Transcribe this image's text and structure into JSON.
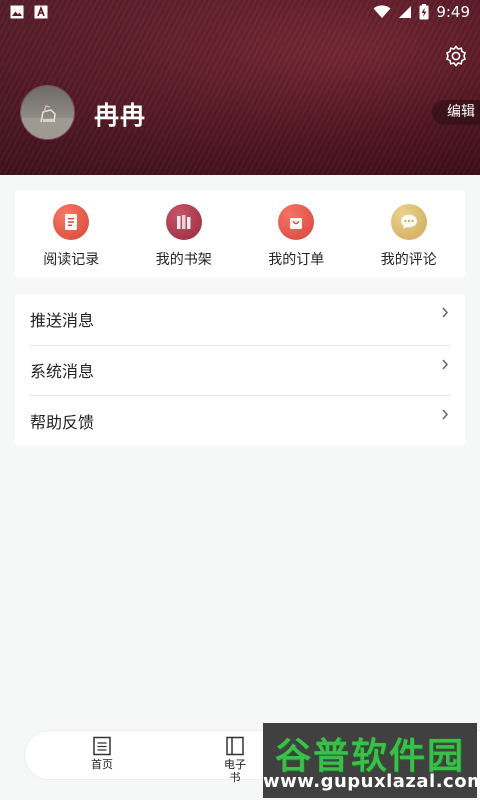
{
  "status_bar": {
    "time": "9:49",
    "left_icons": [
      "gallery-icon",
      "text-app-icon"
    ],
    "right_icons": [
      "wifi-icon",
      "signal-icon",
      "battery-charging-icon"
    ]
  },
  "profile": {
    "username": "冉冉",
    "edit_label": "编辑",
    "settings_icon": "gear-icon",
    "header_color": "#5c1623"
  },
  "quick_actions": [
    {
      "label": "阅读记录",
      "icon": "reading-history-icon",
      "color": "#e85a4a"
    },
    {
      "label": "我的书架",
      "icon": "bookshelf-icon",
      "color": "#b23a4e"
    },
    {
      "label": "我的订单",
      "icon": "shopping-bag-icon",
      "color": "#e8564a"
    },
    {
      "label": "我的评论",
      "icon": "chat-bubble-icon",
      "color": "#dcbc6e"
    }
  ],
  "menu": [
    {
      "label": "推送消息"
    },
    {
      "label": "系统消息"
    },
    {
      "label": "帮助反馈"
    }
  ],
  "bottom_nav": [
    {
      "label": "首页",
      "icon": "home-page-icon"
    },
    {
      "label": "电子书",
      "icon": "book-icon"
    }
  ],
  "watermark": {
    "logo": "谷普软件园",
    "url": "www.gupuxlazal.com"
  }
}
